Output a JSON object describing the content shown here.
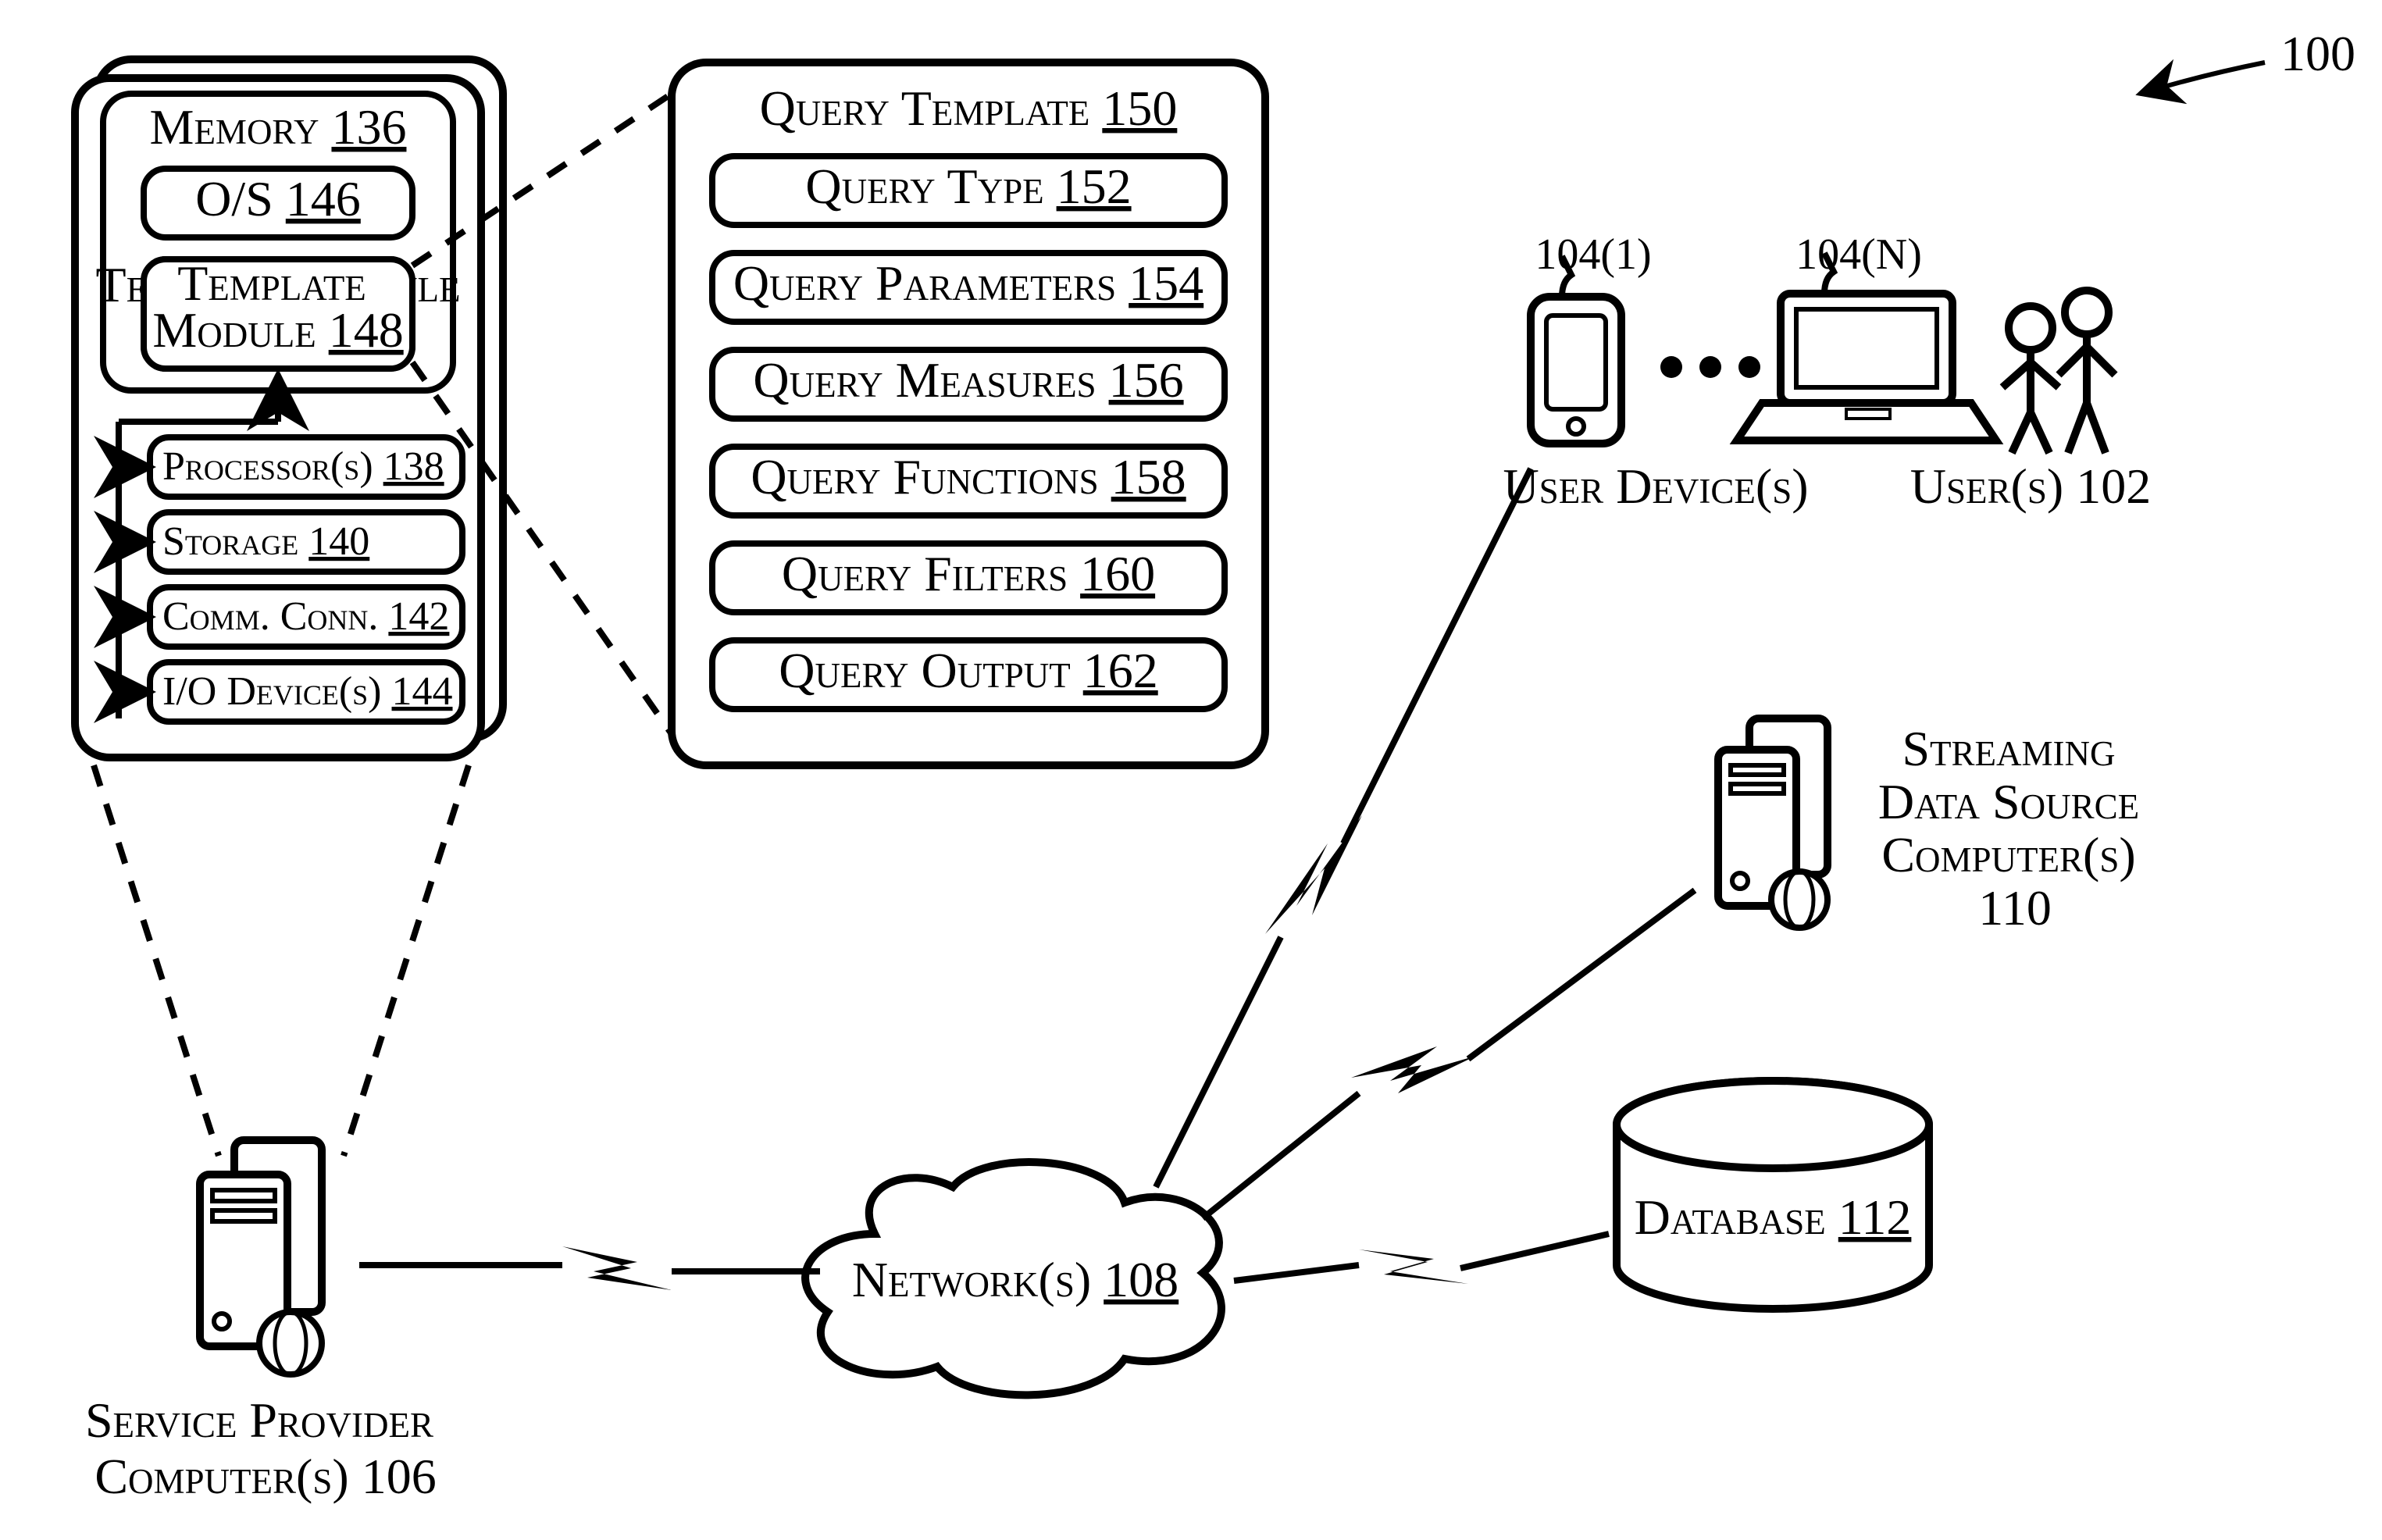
{
  "figure_ref": "100",
  "memory": {
    "label": "Memory",
    "ref": "136"
  },
  "os": {
    "label": "O/S",
    "ref": "146"
  },
  "template_module": {
    "label": "Template Module",
    "ref": "148"
  },
  "processors": {
    "label": "Processor(s)",
    "ref": "138"
  },
  "storage": {
    "label": "Storage",
    "ref": "140"
  },
  "comm_conn": {
    "label": "Comm. Conn.",
    "ref": "142"
  },
  "io_devices": {
    "label": "I/O Device(s)",
    "ref": "144"
  },
  "query_template": {
    "label": "Query Template",
    "ref": "150"
  },
  "query_type": {
    "label": "Query Type",
    "ref": "152"
  },
  "query_parameters": {
    "label": "Query Parameters",
    "ref": "154"
  },
  "query_measures": {
    "label": "Query Measures",
    "ref": "156"
  },
  "query_functions": {
    "label": "Query Functions",
    "ref": "158"
  },
  "query_filters": {
    "label": "Query Filters",
    "ref": "160"
  },
  "query_output": {
    "label": "Query Output",
    "ref": "162"
  },
  "user_device_first": "104(1)",
  "user_device_last": "104(N)",
  "user_devices_label": "User Device(s)",
  "users_label": "User(s)",
  "users_ref": "102",
  "network": {
    "label": "Network(s)",
    "ref": "108"
  },
  "service_provider": {
    "label": "Service Provider Computer(s)",
    "ref": "106"
  },
  "streaming_source": {
    "label": "Streaming Data Source Computer(s)",
    "ref": "110"
  },
  "database": {
    "label": "Database",
    "ref": "112"
  }
}
